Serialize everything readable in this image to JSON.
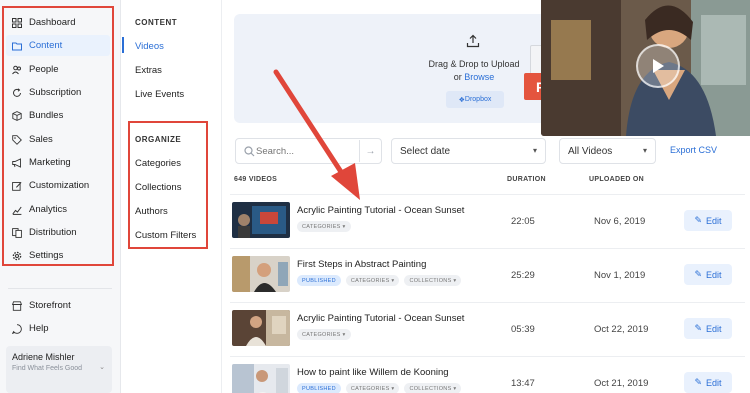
{
  "nav": {
    "items": [
      {
        "label": "Dashboard",
        "icon": "grid-icon",
        "active": false
      },
      {
        "label": "Content",
        "icon": "folder-icon",
        "active": true
      },
      {
        "label": "People",
        "icon": "people-icon",
        "active": false
      },
      {
        "label": "Subscription",
        "icon": "refresh-icon",
        "active": false
      },
      {
        "label": "Bundles",
        "icon": "box-icon",
        "active": false
      },
      {
        "label": "Sales",
        "icon": "tag-icon",
        "active": false
      },
      {
        "label": "Marketing",
        "icon": "megaphone-icon",
        "active": false
      },
      {
        "label": "Customization",
        "icon": "edit-icon",
        "active": false
      },
      {
        "label": "Analytics",
        "icon": "chart-icon",
        "active": false
      },
      {
        "label": "Distribution",
        "icon": "distribution-icon",
        "active": false
      },
      {
        "label": "Settings",
        "icon": "gear-icon",
        "active": false
      }
    ],
    "storefront": "Storefront",
    "help": "Help",
    "user": {
      "name": "Adriene Mishler",
      "subtitle": "Find What Feels Good"
    }
  },
  "subnav": {
    "content_heading": "CONTENT",
    "content_items": [
      "Videos",
      "Extras",
      "Live Events"
    ],
    "organize_heading": "ORGANIZE",
    "organize_items": [
      "Categories",
      "Collections",
      "Authors",
      "Custom Filters"
    ]
  },
  "upload": {
    "line1": "Drag & Drop to Upload",
    "line2_prefix": "or",
    "line2_link": "Browse",
    "dropbox": "Dropbox",
    "pdf_badge": "PDF"
  },
  "toolbar": {
    "search_placeholder": "Search...",
    "date_select": "Select date",
    "filter_select": "All Videos",
    "export": "Export CSV"
  },
  "table": {
    "count_header": "649 VIDEOS",
    "duration_header": "DURATION",
    "uploaded_header": "UPLOADED ON",
    "edit_label": "Edit",
    "rows": [
      {
        "title": "Acrylic Painting Tutorial - Ocean Sunset",
        "tags": [
          "CATEGORIES"
        ],
        "duration": "22:05",
        "date": "Nov 6, 2019"
      },
      {
        "title": "First Steps in Abstract Painting",
        "tags": [
          "PUBLISHED",
          "CATEGORIES",
          "COLLECTIONS"
        ],
        "duration": "25:29",
        "date": "Nov 1, 2019"
      },
      {
        "title": "Acrylic Painting Tutorial - Ocean Sunset",
        "tags": [
          "CATEGORIES"
        ],
        "duration": "05:39",
        "date": "Oct 22, 2019"
      },
      {
        "title": "How to paint like Willem de Kooning",
        "tags": [
          "PUBLISHED",
          "CATEGORIES",
          "COLLECTIONS"
        ],
        "duration": "13:47",
        "date": "Oct 21, 2019"
      }
    ]
  },
  "colors": {
    "accent": "#2b6fd6",
    "highlight": "#e0463a",
    "pdf": "#e4553e"
  }
}
